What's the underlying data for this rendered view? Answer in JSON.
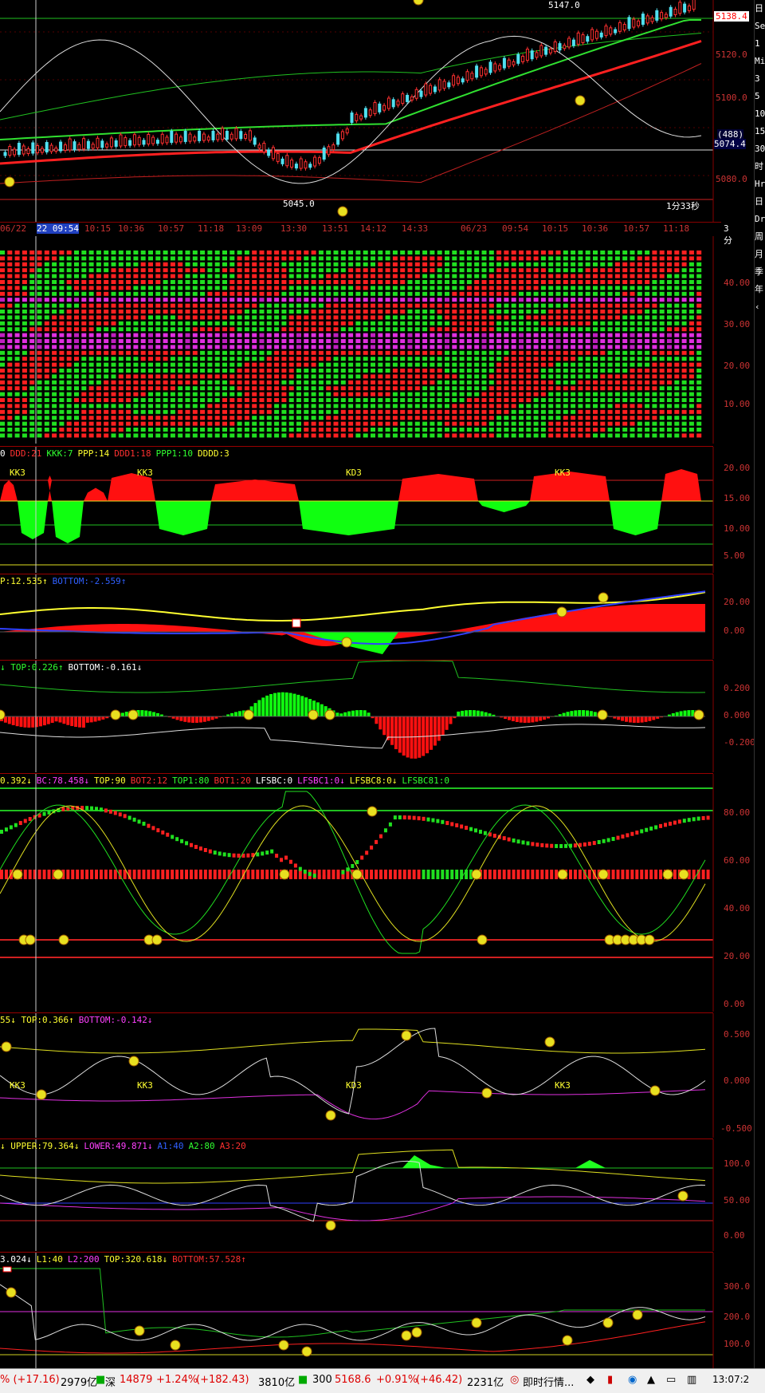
{
  "main_chart": {
    "high_label": "5147.0",
    "low_label": "5045.0",
    "price_axis": [
      "5120.0",
      "5100.0",
      "5080.0"
    ],
    "current_price": "5138.4",
    "cross_label_top": "(488)",
    "cross_label_val": "5074.4",
    "period_label": "1分33秒",
    "time_ticks": [
      "06/22",
      "22 09:54",
      "10:15",
      "10:36",
      "10:57",
      "11:18",
      "13:09",
      "13:30",
      "13:51",
      "14:12",
      "14:33",
      "06/23",
      "09:54",
      "10:15",
      "10:36",
      "10:57",
      "11:18"
    ],
    "period_btn": "3分",
    "colors": {
      "up": "#ff2020",
      "down": "#50e0f0",
      "ma": "#ff2020",
      "band": "#20c020"
    }
  },
  "pane_grid": {
    "axis": [
      "40.00",
      "30.00",
      "20.00",
      "10.00"
    ]
  },
  "pane_kk": {
    "header": [
      {
        "t": "0",
        "c": "#fff"
      },
      {
        "t": "DDD:21",
        "c": "#ff3030"
      },
      {
        "t": "KKK:7",
        "c": "#30ff30"
      },
      {
        "t": "PPP:14",
        "c": "#ffff30"
      },
      {
        "t": "DDD1:18",
        "c": "#ff3030"
      },
      {
        "t": "PPP1:10",
        "c": "#30ff30"
      },
      {
        "t": "DDDD:3",
        "c": "#ffff30"
      }
    ],
    "labels": [
      "KK3",
      "KK3",
      "KD3",
      "KK3"
    ],
    "axis": [
      "20.00",
      "15.00",
      "10.00",
      "5.00"
    ]
  },
  "pane_macd": {
    "header": [
      {
        "t": "P:12.535↑",
        "c": "#ffff30"
      },
      {
        "t": "BOTTOM:-2.559↑",
        "c": "#3060ff"
      }
    ],
    "axis": [
      "20.00",
      "0.00"
    ]
  },
  "pane_osc": {
    "header": [
      {
        "t": "↓ TOP:0.226↑",
        "c": "#30ff30"
      },
      {
        "t": "BOTTOM:-0.161↓",
        "c": "#fff"
      }
    ],
    "axis": [
      "0.200",
      "0.000",
      "-0.200"
    ]
  },
  "pane_kdj": {
    "header": [
      {
        "t": "0.392↓",
        "c": "#ffff30"
      },
      {
        "t": "BC:78.458↓",
        "c": "#ff40ff"
      },
      {
        "t": "TOP:90",
        "c": "#ffff30"
      },
      {
        "t": "BOT2:12",
        "c": "#ff3030"
      },
      {
        "t": "TOP1:80",
        "c": "#30ff30"
      },
      {
        "t": "BOT1:20",
        "c": "#ff3030"
      },
      {
        "t": "LFSBC:0",
        "c": "#fff"
      },
      {
        "t": "LFSBC1:0↓",
        "c": "#ff40ff"
      },
      {
        "t": "LFSBC8:0↓",
        "c": "#ffff30"
      },
      {
        "t": "LFSBC81:0",
        "c": "#30ff30"
      }
    ],
    "axis": [
      "80.00",
      "60.00",
      "40.00",
      "20.00",
      "0.00"
    ]
  },
  "pane_line1": {
    "header": [
      {
        "t": "55↓ TOP:0.366↑",
        "c": "#ffff30"
      },
      {
        "t": "BOTTOM:-0.142↓",
        "c": "#ff40ff"
      }
    ],
    "labels": [
      "KK3",
      "KK3",
      "KD3",
      "KK3"
    ],
    "axis": [
      "0.500",
      "0.000",
      "-0.500"
    ]
  },
  "pane_line2": {
    "header": [
      {
        "t": "↓ UPPER:79.364↓",
        "c": "#ffff30"
      },
      {
        "t": "LOWER:49.871↓",
        "c": "#ff40ff"
      },
      {
        "t": "A1:40",
        "c": "#3060ff"
      },
      {
        "t": "A2:80",
        "c": "#30ff30"
      },
      {
        "t": "A3:20",
        "c": "#ff3030"
      }
    ],
    "axis": [
      "100.0",
      "50.00",
      "0.00"
    ]
  },
  "pane_line3": {
    "header": [
      {
        "t": "3.024↓",
        "c": "#fff"
      },
      {
        "t": "L1:40",
        "c": "#ffff30"
      },
      {
        "t": "L2:200",
        "c": "#ff40ff"
      },
      {
        "t": "TOP:320.618↓",
        "c": "#ffff30"
      },
      {
        "t": "BOTTOM:57.528↑",
        "c": "#ff3030"
      }
    ],
    "axis": [
      "300.0",
      "200.0",
      "100.0"
    ]
  },
  "sidebar": [
    "日",
    "Se",
    "1",
    "Mi",
    "3",
    "5",
    "10",
    "15",
    "30",
    "时",
    "Hr",
    "日",
    "Dr",
    "周",
    "月",
    "季",
    "年",
    "‹"
  ],
  "status_bar": {
    "sh_change": "% (+17.16)",
    "sh_amount": "2979亿",
    "sz_name": "深",
    "sz_index": "14879",
    "sz_pct": "+1.24%",
    "sz_change": "(+182.43)",
    "sz_amount": "3810亿",
    "c300_name": "300",
    "c300_index": "5168.6",
    "c300_pct": "+0.91%",
    "c300_change": "(+46.42)",
    "c300_amount": "2231亿",
    "news_label": "即时行情...",
    "clock": "13:07:2"
  }
}
